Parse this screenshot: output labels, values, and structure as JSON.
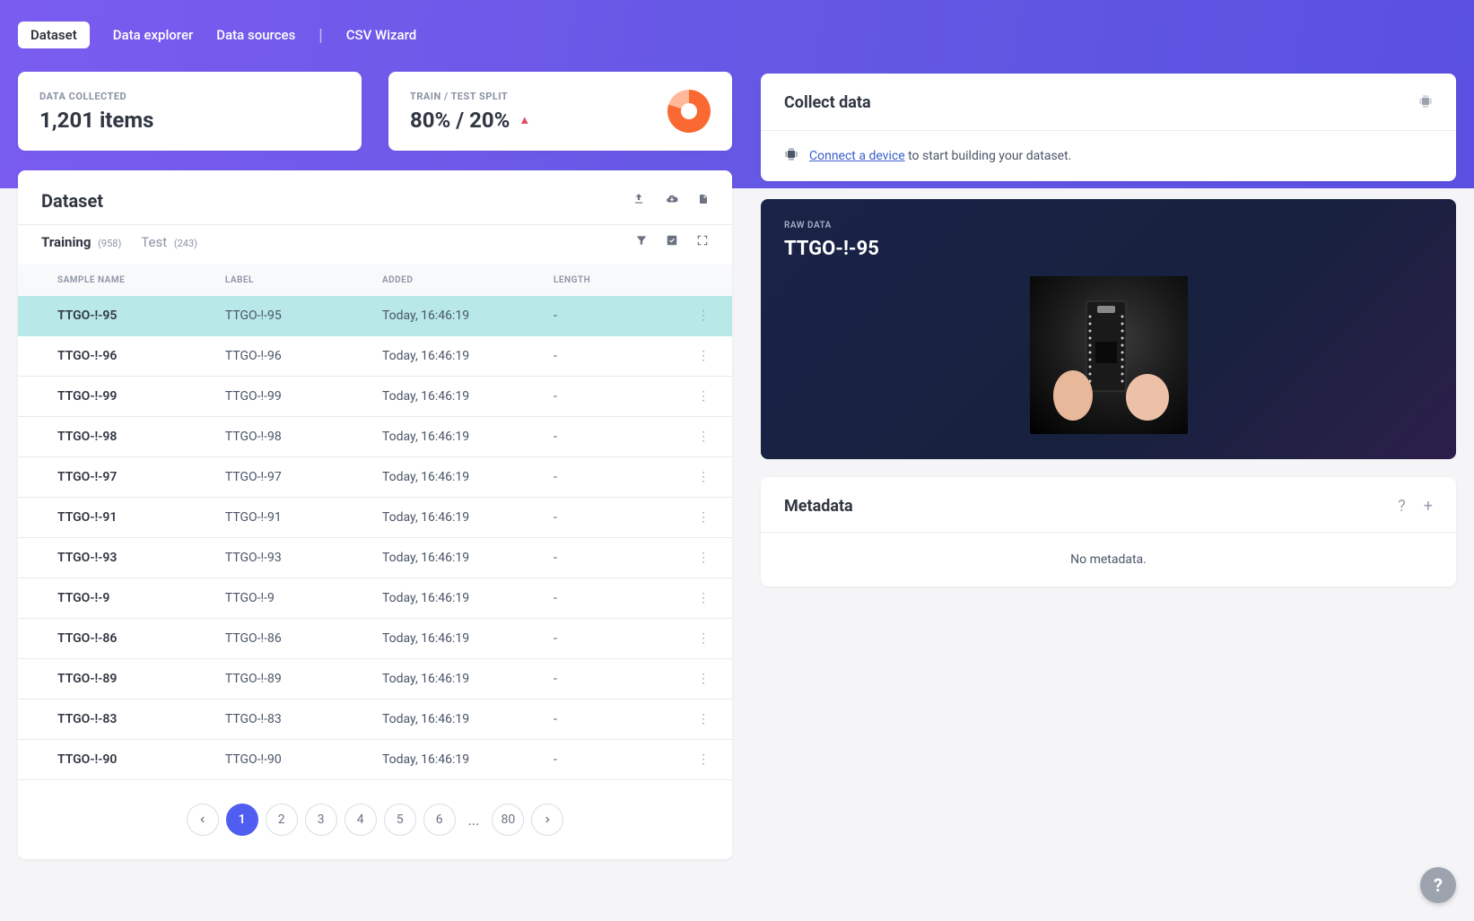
{
  "nav": {
    "active": "Dataset",
    "items": [
      "Data explorer",
      "Data sources"
    ],
    "wizard": "CSV Wizard"
  },
  "stats": {
    "collected_label": "DATA COLLECTED",
    "collected_value": "1,201 items",
    "split_label": "TRAIN / TEST SPLIT",
    "split_value": "80% / 20%"
  },
  "dataset_panel": {
    "title": "Dataset",
    "tabs": {
      "training_label": "Training",
      "training_count": "(958)",
      "test_label": "Test",
      "test_count": "(243)"
    },
    "columns": {
      "sample": "SAMPLE NAME",
      "label": "LABEL",
      "added": "ADDED",
      "length": "LENGTH"
    },
    "rows": [
      {
        "name": "TTGO-!-95",
        "label": "TTGO-!-95",
        "added": "Today, 16:46:19",
        "length": "-",
        "selected": true
      },
      {
        "name": "TTGO-!-96",
        "label": "TTGO-!-96",
        "added": "Today, 16:46:19",
        "length": "-"
      },
      {
        "name": "TTGO-!-99",
        "label": "TTGO-!-99",
        "added": "Today, 16:46:19",
        "length": "-"
      },
      {
        "name": "TTGO-!-98",
        "label": "TTGO-!-98",
        "added": "Today, 16:46:19",
        "length": "-"
      },
      {
        "name": "TTGO-!-97",
        "label": "TTGO-!-97",
        "added": "Today, 16:46:19",
        "length": "-"
      },
      {
        "name": "TTGO-!-91",
        "label": "TTGO-!-91",
        "added": "Today, 16:46:19",
        "length": "-"
      },
      {
        "name": "TTGO-!-93",
        "label": "TTGO-!-93",
        "added": "Today, 16:46:19",
        "length": "-"
      },
      {
        "name": "TTGO-!-9",
        "label": "TTGO-!-9",
        "added": "Today, 16:46:19",
        "length": "-"
      },
      {
        "name": "TTGO-!-86",
        "label": "TTGO-!-86",
        "added": "Today, 16:46:19",
        "length": "-"
      },
      {
        "name": "TTGO-!-89",
        "label": "TTGO-!-89",
        "added": "Today, 16:46:19",
        "length": "-"
      },
      {
        "name": "TTGO-!-83",
        "label": "TTGO-!-83",
        "added": "Today, 16:46:19",
        "length": "-"
      },
      {
        "name": "TTGO-!-90",
        "label": "TTGO-!-90",
        "added": "Today, 16:46:19",
        "length": "-"
      }
    ],
    "pagination": {
      "pages": [
        "1",
        "2",
        "3",
        "4",
        "5",
        "6"
      ],
      "ellipsis": "...",
      "last": "80",
      "active": "1"
    }
  },
  "collect": {
    "title": "Collect data",
    "link_text": "Connect a device",
    "suffix": " to start building your dataset."
  },
  "raw": {
    "heading": "RAW DATA",
    "title": "TTGO-!-95"
  },
  "metadata": {
    "title": "Metadata",
    "empty": "No metadata."
  }
}
